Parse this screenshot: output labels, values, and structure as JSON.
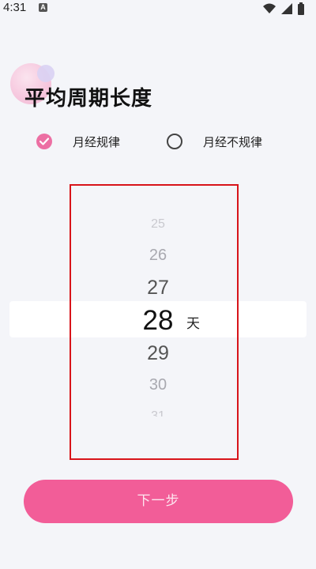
{
  "status_bar": {
    "time": "4:31",
    "notification_letter": "A"
  },
  "page": {
    "title": "平均周期长度"
  },
  "options": {
    "regular": {
      "label": "月经规律",
      "selected": true
    },
    "irregular": {
      "label": "月经不规律",
      "selected": false
    }
  },
  "picker": {
    "values": [
      "25",
      "26",
      "27",
      "28",
      "29",
      "30",
      "31"
    ],
    "selected_value": "28",
    "unit": "天"
  },
  "next_button": {
    "label": "下一步"
  },
  "colors": {
    "accent": "#ec6fa3",
    "button": "#f25d98",
    "highlight_frame": "#d8141a",
    "background": "#f4f5f9"
  }
}
